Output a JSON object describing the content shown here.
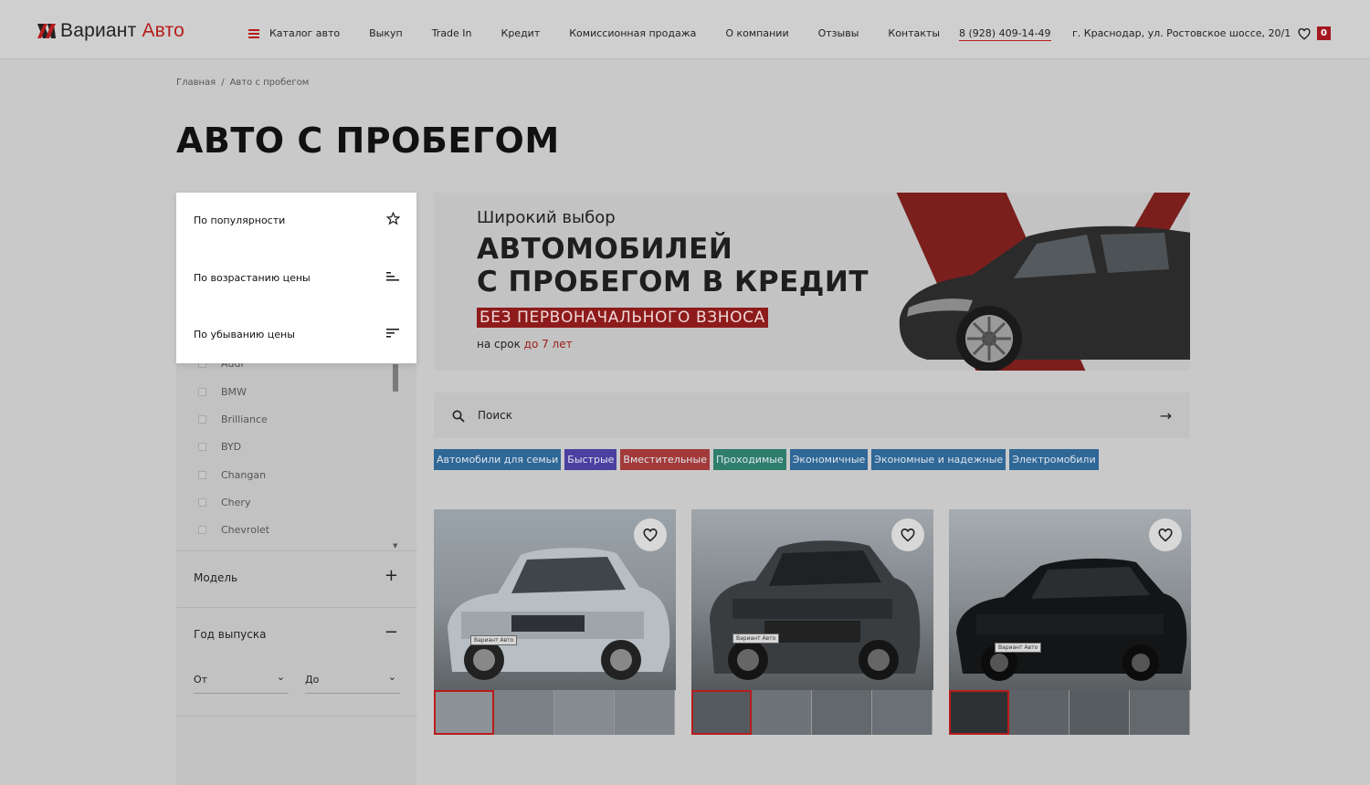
{
  "header": {
    "logo_text_1": "Вариант",
    "logo_text_2": "Авто",
    "nav": {
      "catalog": "Каталог авто",
      "buyout": "Выкуп",
      "tradein": "Trade In",
      "credit": "Кредит",
      "commission": "Комиссионная продажа",
      "about": "О компании",
      "reviews": "Отзывы",
      "contacts": "Контакты"
    },
    "phone": "8 (928) 409-14-49",
    "address": "г. Краснодар, ул. Ростовское шоссе, 20/1",
    "favorites_count": "0"
  },
  "breadcrumb": {
    "home": "Главная",
    "separator": "/",
    "current": "Авто с пробегом"
  },
  "page_title": "АВТО С ПРОБЕГОМ",
  "sort_menu": {
    "popularity": "По популярности",
    "price_asc": "По возрастанию цены",
    "price_desc": "По убыванию цены"
  },
  "brands": {
    "audi": "Audi",
    "bmw": "BMW",
    "brilliance": "Brilliance",
    "byd": "BYD",
    "changan": "Changan",
    "chery": "Chery",
    "chevrolet": "Chevrolet"
  },
  "filters": {
    "model": "Модель",
    "model_sign": "+",
    "year": "Год выпуска",
    "year_sign": "−",
    "year_from": "От",
    "year_to": "До"
  },
  "banner": {
    "subtitle": "Широкий выбор",
    "title_line1": "АВТОМОБИЛЕЙ",
    "title_line2": "С ПРОБЕГОМ В КРЕДИТ",
    "tag": "БЕЗ ПЕРВОНАЧАЛЬНОГО ВЗНОСА",
    "term_prefix": "на срок",
    "term_value": "до 7 лет"
  },
  "search": {
    "placeholder": "Поиск"
  },
  "tags": {
    "family": {
      "label": "Автомобили для семьи",
      "color": "#2f6796"
    },
    "fast": {
      "label": "Быстрые",
      "color": "#4b3fa0"
    },
    "spacious": {
      "label": "Вместительные",
      "color": "#a33a3a"
    },
    "offroad": {
      "label": "Проходимые",
      "color": "#2f7e6c"
    },
    "economy": {
      "label": "Экономичные",
      "color": "#2f6796"
    },
    "economy_reliable": {
      "label": "Экономные и надежные",
      "color": "#2f6796"
    },
    "electric": {
      "label": "Электромобили",
      "color": "#2f6796"
    }
  },
  "cards": {
    "plate_text": "Вариант Авто"
  },
  "colors": {
    "accent": "#b71c1c"
  }
}
